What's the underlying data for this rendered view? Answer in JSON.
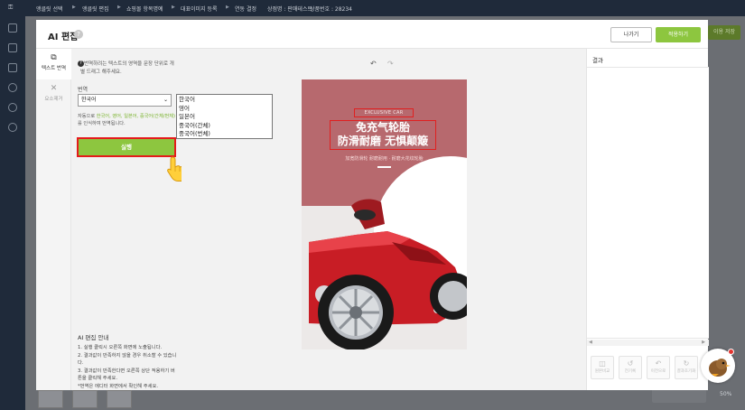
{
  "background": {
    "topbar": {
      "items": [
        "앵클릿 선택",
        "앵클릿 편집",
        "쇼핑몰 항목명예",
        "대표이미지 등록",
        "연동 결정",
        "상점명 : 판매테스트",
        "상품번호 : 28234"
      ]
    },
    "right_button_label": "이용 저장",
    "zoom_label": "50%"
  },
  "modal": {
    "title": "AI 편집",
    "help_icon_glyph": "?",
    "exit_label": "나가기",
    "apply_label": "적용하기"
  },
  "tabs": [
    {
      "label": "텍스트 번역",
      "icon": "text-translate-icon",
      "glyph": "⧉"
    },
    {
      "label": "요소제거",
      "icon": "eraser-icon",
      "glyph": "✕"
    }
  ],
  "panel": {
    "instruction_bullet": "?",
    "instruction": "번역하려는 텍스트의 영역을 문장 단위로 개별 드래그 해주세요.",
    "language_label": "번역",
    "selected_language": "한국어",
    "auto_note_prefix": "자동으로 ",
    "auto_note_langs": "한국어, 영어, 일본어, 중국어(간체/번체)",
    "auto_note_suffix": "를 인식하여 번역됩니다.",
    "run_label": "실행",
    "guide_title": "AI 편집 안내",
    "guide_lines": [
      "1. 실행 클릭시 오른쪽 화면에 노출됩니다.",
      "2. 결과값이 만족하지 않을 경우 취소할 수 있습니다.",
      "3. 결과값이 만족한다면 오른쪽 상단 적용하기 버튼을 클릭해 주세요.",
      "*번역은 에디터 화면에서 확인해 주세요."
    ]
  },
  "language_options": [
    "한국어",
    "영어",
    "일본어",
    "중국어(간체)",
    "중국어(번체)"
  ],
  "canvas": {
    "undo_glyph": "↶",
    "redo_glyph": "↷",
    "art_tag": "EXCLUSIVE CAR",
    "art_title_line1": "免充气轮胎",
    "art_title_line2": "防滑耐磨 无惧颠簸",
    "art_subtitle": "加宽防滑轮 耐磨耐用 · 耐磨大花纹轮胎"
  },
  "results": {
    "title": "결과",
    "scroll_left": "◀",
    "scroll_right": "▶",
    "actions": [
      {
        "label": "원본비교",
        "icon": "compare-icon",
        "glyph": "◫"
      },
      {
        "label": "전기록",
        "icon": "history-icon",
        "glyph": "↺"
      },
      {
        "label": "이전으로",
        "icon": "undo-icon",
        "glyph": "↶"
      },
      {
        "label": "결과초기화",
        "icon": "reset-icon",
        "glyph": "↻"
      }
    ]
  },
  "colors": {
    "accent_green": "#8dc63f",
    "highlight_red": "#e41b1b",
    "topbar_navy": "#1f2a3a"
  }
}
